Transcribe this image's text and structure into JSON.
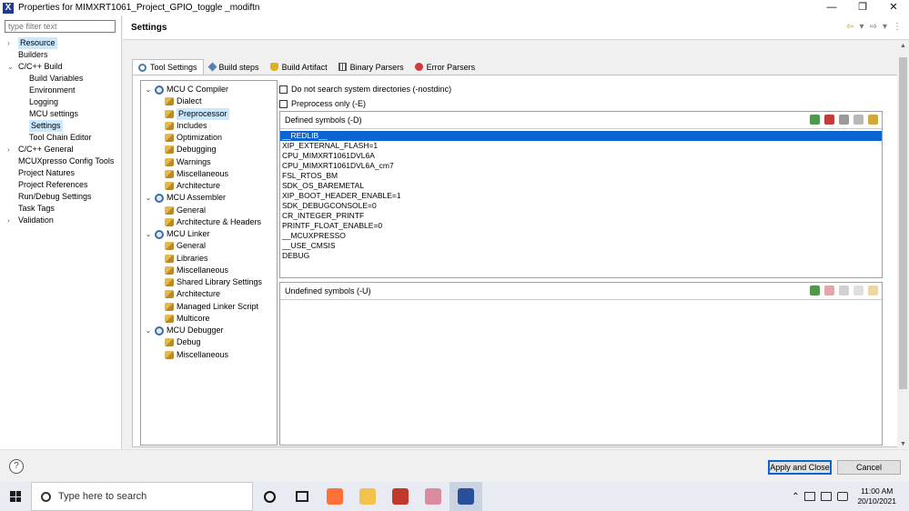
{
  "window": {
    "title": "Properties for MIMXRT1061_Project_GPIO_toggle _modiftn",
    "app_icon": "X",
    "controls": [
      "—",
      "❐",
      "✕"
    ]
  },
  "nav": {
    "filter_placeholder": "type filter text",
    "items": [
      {
        "label": "Resource",
        "level": 0,
        "chevron": "›",
        "selected": true
      },
      {
        "label": "Builders",
        "level": 0,
        "chevron": ""
      },
      {
        "label": "C/C++ Build",
        "level": 0,
        "chevron": "⌄"
      },
      {
        "label": "Build Variables",
        "level": 1,
        "chevron": ""
      },
      {
        "label": "Environment",
        "level": 1,
        "chevron": ""
      },
      {
        "label": "Logging",
        "level": 1,
        "chevron": ""
      },
      {
        "label": "MCU settings",
        "level": 1,
        "chevron": ""
      },
      {
        "label": "Settings",
        "level": 1,
        "chevron": "",
        "selected": true
      },
      {
        "label": "Tool Chain Editor",
        "level": 1,
        "chevron": ""
      },
      {
        "label": "C/C++ General",
        "level": 0,
        "chevron": "›"
      },
      {
        "label": "MCUXpresso Config Tools",
        "level": 0,
        "chevron": ""
      },
      {
        "label": "Project Natures",
        "level": 0,
        "chevron": ""
      },
      {
        "label": "Project References",
        "level": 0,
        "chevron": ""
      },
      {
        "label": "Run/Debug Settings",
        "level": 0,
        "chevron": ""
      },
      {
        "label": "Task Tags",
        "level": 0,
        "chevron": ""
      },
      {
        "label": "Validation",
        "level": 0,
        "chevron": "›"
      }
    ]
  },
  "settings": {
    "title": "Settings",
    "header_icons": [
      "⇦",
      "▾",
      "⇨",
      "▾",
      "⋮"
    ],
    "tabs": [
      {
        "label": "Tool Settings",
        "icon": "gear-icon",
        "active": true
      },
      {
        "label": "Build steps",
        "icon": "hammer-icon"
      },
      {
        "label": "Build Artifact",
        "icon": "trophy-icon"
      },
      {
        "label": "Binary Parsers",
        "icon": "binary-icon"
      },
      {
        "label": "Error Parsers",
        "icon": "error-icon"
      }
    ],
    "tree": [
      {
        "label": "MCU C Compiler",
        "kind": "tool",
        "twist": "⌄"
      },
      {
        "label": "Dialect",
        "kind": "opt"
      },
      {
        "label": "Preprocessor",
        "kind": "opt",
        "selected": true
      },
      {
        "label": "Includes",
        "kind": "opt"
      },
      {
        "label": "Optimization",
        "kind": "opt"
      },
      {
        "label": "Debugging",
        "kind": "opt"
      },
      {
        "label": "Warnings",
        "kind": "opt"
      },
      {
        "label": "Miscellaneous",
        "kind": "opt"
      },
      {
        "label": "Architecture",
        "kind": "opt"
      },
      {
        "label": "MCU Assembler",
        "kind": "tool",
        "twist": "⌄"
      },
      {
        "label": "General",
        "kind": "opt"
      },
      {
        "label": "Architecture & Headers",
        "kind": "opt"
      },
      {
        "label": "MCU Linker",
        "kind": "tool",
        "twist": "⌄"
      },
      {
        "label": "General",
        "kind": "opt"
      },
      {
        "label": "Libraries",
        "kind": "opt"
      },
      {
        "label": "Miscellaneous",
        "kind": "opt"
      },
      {
        "label": "Shared Library Settings",
        "kind": "opt"
      },
      {
        "label": "Architecture",
        "kind": "opt"
      },
      {
        "label": "Managed Linker Script",
        "kind": "opt"
      },
      {
        "label": "Multicore",
        "kind": "opt"
      },
      {
        "label": "MCU Debugger",
        "kind": "tool",
        "twist": "⌄"
      },
      {
        "label": "Debug",
        "kind": "opt"
      },
      {
        "label": "Miscellaneous",
        "kind": "opt"
      }
    ],
    "checkboxes": [
      {
        "label": "Do not search system directories (-nostdinc)",
        "checked": false
      },
      {
        "label": "Preprocess only (-E)",
        "checked": false
      }
    ],
    "defined": {
      "label": "Defined symbols (-D)",
      "symbols": [
        "__REDLIB__",
        "XIP_EXTERNAL_FLASH=1",
        "CPU_MIMXRT1061DVL6A",
        "CPU_MIMXRT1061DVL6A_cm7",
        "FSL_RTOS_BM",
        "SDK_OS_BAREMETAL",
        "XIP_BOOT_HEADER_ENABLE=1",
        "SDK_DEBUGCONSOLE=0",
        "CR_INTEGER_PRINTF",
        "PRINTF_FLOAT_ENABLE=0",
        "__MCUXPRESSO",
        "__USE_CMSIS",
        "DEBUG"
      ],
      "selected_index": 0
    },
    "undefined": {
      "label": "Undefined symbols (-U)",
      "symbols": []
    }
  },
  "buttons": {
    "help": "?",
    "apply": "Apply and Close",
    "cancel": "Cancel"
  },
  "taskbar": {
    "search_placeholder": "Type here to search",
    "time": "11:00 AM",
    "date": "20/10/2021",
    "apps": [
      {
        "name": "firefox-icon",
        "color": "#ff7139"
      },
      {
        "name": "file-explorer-icon",
        "color": "#f2c14e"
      },
      {
        "name": "game-app-icon",
        "color": "#c0392b"
      },
      {
        "name": "paint-app-icon",
        "color": "#d98ca1"
      },
      {
        "name": "mcuxpresso-icon",
        "color": "#2a4f9a",
        "active": true
      }
    ]
  }
}
